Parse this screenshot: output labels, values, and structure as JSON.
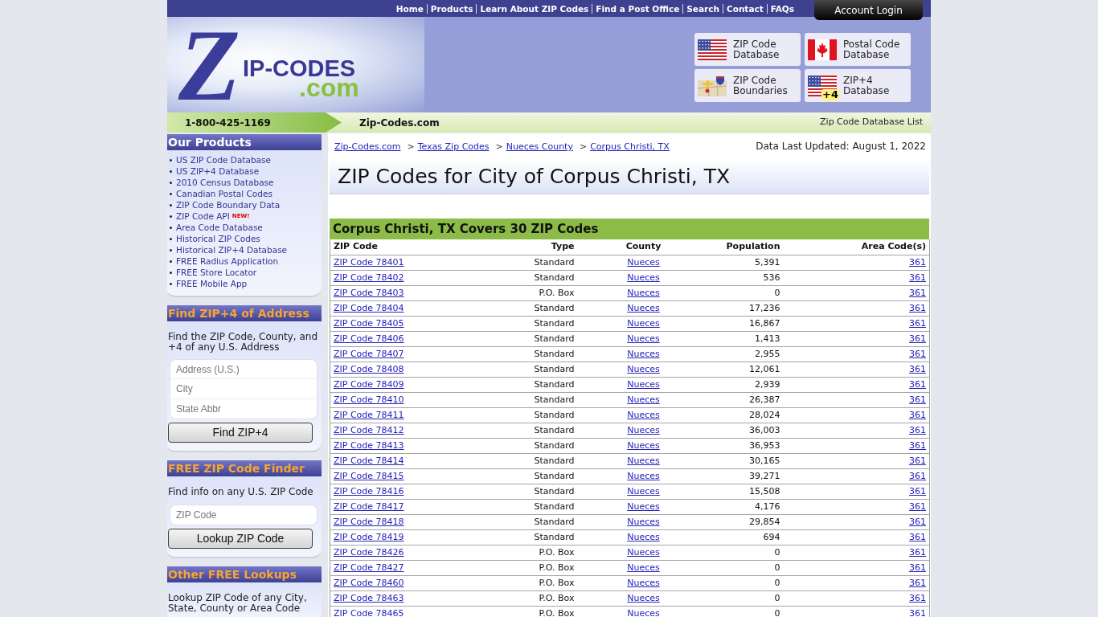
{
  "top_nav": {
    "links": [
      "Home",
      "Products",
      "Learn About ZIP Codes",
      "Find a Post Office",
      "Search",
      "Contact",
      "FAQs"
    ],
    "account_button": "Account Login"
  },
  "logo": {
    "initial": "Z",
    "wordmark": "IP-CODES",
    "domain": ".com"
  },
  "product_tiles": [
    {
      "kind": "us-flag",
      "lines": [
        "ZIP Code",
        "Database"
      ]
    },
    {
      "kind": "canada-flag",
      "lines": [
        "Postal Code",
        "Database"
      ]
    },
    {
      "kind": "map",
      "lines": [
        "ZIP Code",
        "Boundaries"
      ]
    },
    {
      "kind": "us-flag",
      "badge": "+4",
      "lines": [
        "ZIP+4",
        "Database"
      ]
    }
  ],
  "info_bar": {
    "phone": "1-800-425-1169",
    "site": "Zip-Codes.com",
    "link": "Zip Code Database List"
  },
  "sidebar": {
    "panels": [
      {
        "kind": "links",
        "title": "Our Products",
        "items": [
          {
            "label": "US ZIP Code Database"
          },
          {
            "label": "US ZIP+4 Database"
          },
          {
            "label": "2010 Census Database"
          },
          {
            "label": "Canadian Postal Codes"
          },
          {
            "label": "ZIP Code Boundary Data"
          },
          {
            "label": "ZIP Code API",
            "badge": "NEW!"
          },
          {
            "label": "Area Code Database"
          },
          {
            "label": "Historical ZIP Codes"
          },
          {
            "label": "Historical ZIP+4 Database"
          },
          {
            "label": "FREE Radius Application"
          },
          {
            "label": "FREE Store Locator"
          },
          {
            "label": "FREE Mobile App"
          }
        ]
      },
      {
        "kind": "form",
        "title": "Find ZIP+4 of Address",
        "description": "Find the ZIP Code, County, and +4 of any U.S. Address",
        "fields": [
          {
            "placeholder": "Address (U.S.)"
          },
          {
            "placeholder": "City"
          },
          {
            "placeholder": "State Abbr"
          }
        ],
        "button": "Find ZIP+4"
      },
      {
        "kind": "form",
        "title": "FREE ZIP Code Finder",
        "description": "Find info on any U.S. ZIP Code",
        "fields": [
          {
            "placeholder": "ZIP Code"
          }
        ],
        "button": "Lookup ZIP Code"
      },
      {
        "kind": "text",
        "title": "Other FREE Lookups",
        "description": "Lookup ZIP Code of any City, State, County or Area Code"
      }
    ]
  },
  "main": {
    "breadcrumb": [
      {
        "label": "Zip-Codes.com"
      },
      {
        "sep": ">",
        "label": "Texas Zip Codes"
      },
      {
        "sep": ">",
        "label": "Nueces County"
      },
      {
        "sep": ">",
        "label": "Corpus Christi, TX"
      }
    ],
    "updated": "Data Last Updated: August 1, 2022",
    "title": "ZIP Codes for City of Corpus Christi, TX",
    "table": {
      "caption": "Corpus Christi, TX Covers 30 ZIP Codes",
      "columns": [
        "ZIP Code",
        "Type",
        "County",
        "Population",
        "Area Code(s)"
      ],
      "rows": [
        [
          "ZIP Code 78401",
          "Standard",
          "Nueces",
          "5,391",
          "361"
        ],
        [
          "ZIP Code 78402",
          "Standard",
          "Nueces",
          "536",
          "361"
        ],
        [
          "ZIP Code 78403",
          "P.O. Box",
          "Nueces",
          "0",
          "361"
        ],
        [
          "ZIP Code 78404",
          "Standard",
          "Nueces",
          "17,236",
          "361"
        ],
        [
          "ZIP Code 78405",
          "Standard",
          "Nueces",
          "16,867",
          "361"
        ],
        [
          "ZIP Code 78406",
          "Standard",
          "Nueces",
          "1,413",
          "361"
        ],
        [
          "ZIP Code 78407",
          "Standard",
          "Nueces",
          "2,955",
          "361"
        ],
        [
          "ZIP Code 78408",
          "Standard",
          "Nueces",
          "12,061",
          "361"
        ],
        [
          "ZIP Code 78409",
          "Standard",
          "Nueces",
          "2,939",
          "361"
        ],
        [
          "ZIP Code 78410",
          "Standard",
          "Nueces",
          "26,387",
          "361"
        ],
        [
          "ZIP Code 78411",
          "Standard",
          "Nueces",
          "28,024",
          "361"
        ],
        [
          "ZIP Code 78412",
          "Standard",
          "Nueces",
          "36,003",
          "361"
        ],
        [
          "ZIP Code 78413",
          "Standard",
          "Nueces",
          "36,953",
          "361"
        ],
        [
          "ZIP Code 78414",
          "Standard",
          "Nueces",
          "30,165",
          "361"
        ],
        [
          "ZIP Code 78415",
          "Standard",
          "Nueces",
          "39,271",
          "361"
        ],
        [
          "ZIP Code 78416",
          "Standard",
          "Nueces",
          "15,508",
          "361"
        ],
        [
          "ZIP Code 78417",
          "Standard",
          "Nueces",
          "4,176",
          "361"
        ],
        [
          "ZIP Code 78418",
          "Standard",
          "Nueces",
          "29,854",
          "361"
        ],
        [
          "ZIP Code 78419",
          "Standard",
          "Nueces",
          "694",
          "361"
        ],
        [
          "ZIP Code 78426",
          "P.O. Box",
          "Nueces",
          "0",
          "361"
        ],
        [
          "ZIP Code 78427",
          "P.O. Box",
          "Nueces",
          "0",
          "361"
        ],
        [
          "ZIP Code 78460",
          "P.O. Box",
          "Nueces",
          "0",
          "361"
        ],
        [
          "ZIP Code 78463",
          "P.O. Box",
          "Nueces",
          "0",
          "361"
        ],
        [
          "ZIP Code 78465",
          "P.O. Box",
          "Nueces",
          "0",
          "361"
        ]
      ]
    }
  }
}
